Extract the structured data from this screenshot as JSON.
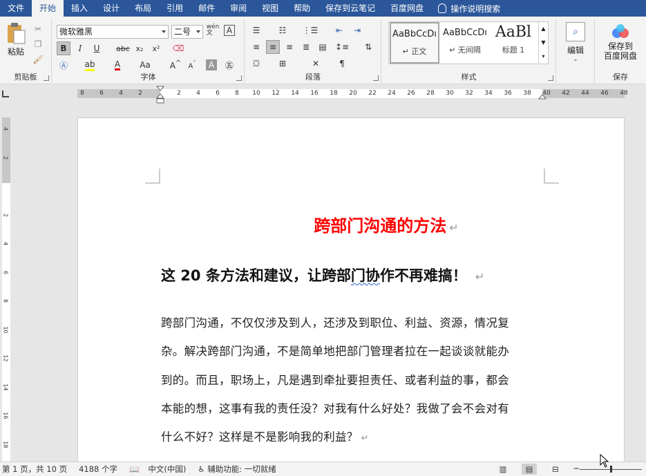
{
  "menu": {
    "tabs": [
      "文件",
      "开始",
      "插入",
      "设计",
      "布局",
      "引用",
      "邮件",
      "审阅",
      "视图",
      "帮助",
      "保存到云笔记",
      "百度网盘"
    ],
    "active_tab": "开始",
    "tell_me": "操作说明搜索"
  },
  "ribbon": {
    "clipboard": {
      "paste_label": "粘贴",
      "group_label": "剪贴板"
    },
    "font": {
      "font_name": "微软雅黑",
      "font_size": "二号",
      "group_label": "字体"
    },
    "paragraph": {
      "group_label": "段落"
    },
    "styles": {
      "items": [
        {
          "preview": "AaBbCcDı",
          "name": "↵ 正文"
        },
        {
          "preview": "AaBbCcDı",
          "name": "↵ 无间隔"
        },
        {
          "preview": "AaBl",
          "name": "标题 1"
        }
      ],
      "group_label": "样式"
    },
    "editing": {
      "label": "编辑"
    },
    "save": {
      "label": "保存到\n百度网盘",
      "label_line1": "保存到",
      "label_line2": "百度网盘",
      "group_label": "保存"
    }
  },
  "ruler": {
    "numbers": [
      "8",
      "6",
      "4",
      "2",
      "",
      "2",
      "4",
      "6",
      "8",
      "10",
      "12",
      "14",
      "16",
      "18",
      "20",
      "22",
      "24",
      "26",
      "28",
      "30",
      "32",
      "34",
      "36",
      "38",
      "40",
      "42",
      "44",
      "46",
      "48"
    ]
  },
  "vruler": {
    "numbers": [
      "4",
      "2",
      "",
      "2",
      "4",
      "6",
      "8",
      "10",
      "12",
      "14",
      "16",
      "18"
    ]
  },
  "document": {
    "title": "跨部门沟通的方法",
    "subtitle_pre": "这 20 条方法和建议，让跨部",
    "subtitle_squig": "门协",
    "subtitle_post": "作不再难搞！",
    "paragraph_lines": [
      "跨部门沟通，不仅仅涉及到人，还涉及到职位、利益、资源，情况复",
      "杂。解决跨部门沟通，不是简单地把部门管理者拉在一起谈谈就能办",
      "到的。而且，职场上，凡是遇到牵扯要担责任、或者利益的事，都会",
      "本能的想，这事有我的责任没？对我有什么好处？我做了会不会对有",
      "什么不好？这样是不是影响我的利益？"
    ],
    "paragraph_mark": "↵"
  },
  "statusbar": {
    "page": "第 1 页，共 10 页",
    "words": "4188 个字",
    "language": "中文(中国)",
    "accessibility": "辅助功能: 一切就绪"
  }
}
